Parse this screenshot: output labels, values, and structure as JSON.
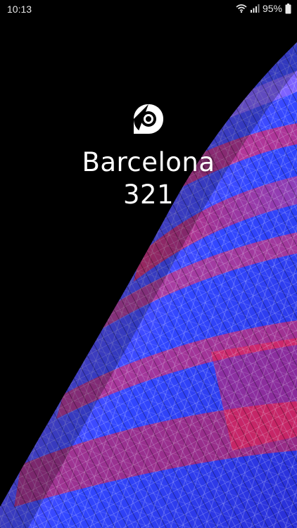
{
  "status_bar": {
    "time": "10:13",
    "battery_percent": "95%",
    "icons": [
      "wifi-icon",
      "signal-icon",
      "battery-icon"
    ]
  },
  "splash": {
    "logo_icon": "location-pin-icon",
    "app_name_line1": "Barcelona",
    "app_name_line2": "321"
  },
  "colors": {
    "background": "#000000",
    "text": "#ffffff",
    "tower_blue": "#3b4cff",
    "tower_red": "#ff2a4a",
    "tower_violet": "#9a6cff"
  }
}
